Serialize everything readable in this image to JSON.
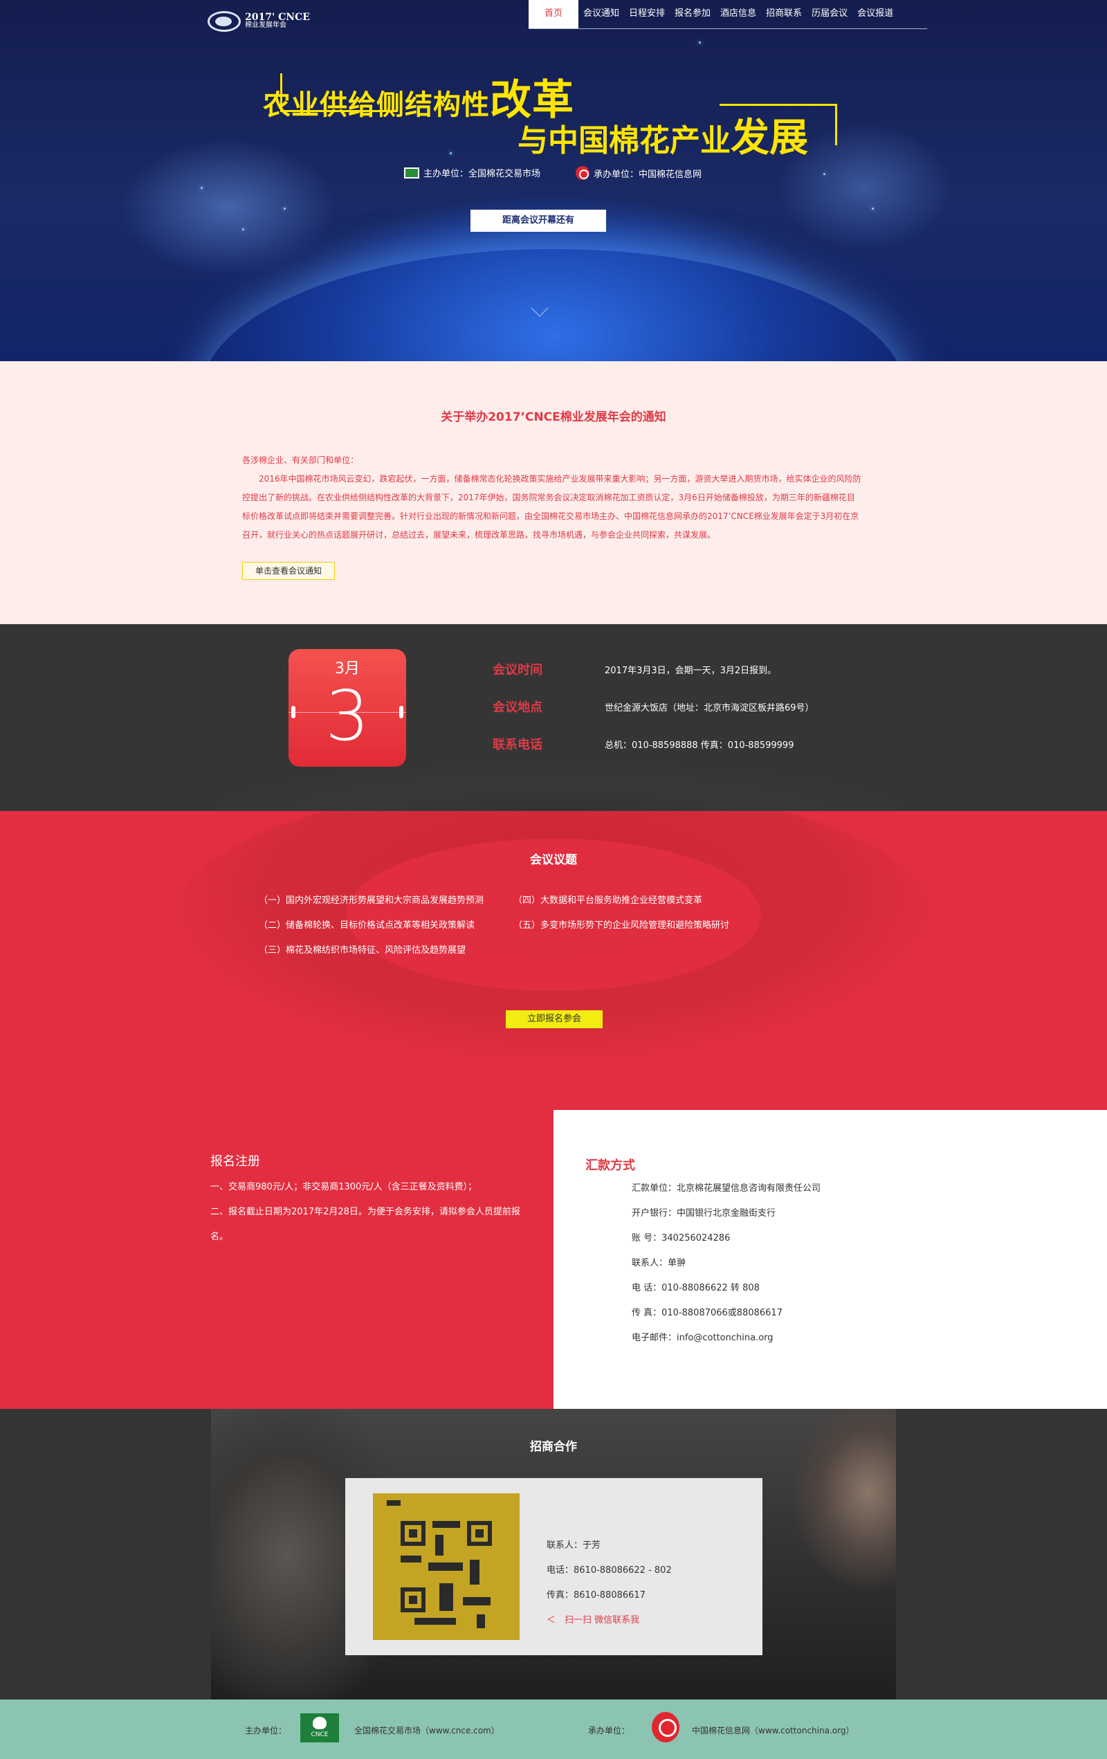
{
  "header": {
    "logo_year": "2017' CNCE",
    "logo_name": "棉业发展年会",
    "nav": [
      {
        "label": "首页",
        "active": true
      },
      {
        "label": "会议通知"
      },
      {
        "label": "日程安排"
      },
      {
        "label": "报名参加"
      },
      {
        "label": "酒店信息"
      },
      {
        "label": "招商联系"
      },
      {
        "label": "历届会议"
      },
      {
        "label": "会议报道"
      }
    ]
  },
  "hero": {
    "title_line1_a": "农业供给侧结构性",
    "title_line1_b": "改革",
    "title_line2_a": "与中国棉花产业",
    "title_line2_b": "发展",
    "host": "主办单位：全国棉花交易市场",
    "organizer": "承办单位：中国棉花信息网",
    "countdown": "距离会议开幕还有"
  },
  "notice": {
    "title": "关于举办2017’CNCE棉业发展年会的通知",
    "greeting": "各涉棉企业、有关部门和单位：",
    "body": "2016年中国棉花市场风云变幻，跌宕起伏，一方面，储备棉常态化轮换政策实施给产业发展带来重大影响；另一方面，游资大举进入期货市场，给实体企业的风险防控提出了新的挑战。在农业供给侧结构性改革的大背景下，2017年伊始，国务院常务会议决定取消棉花加工资质认定，3月6日开始储备棉投放，为期三年的新疆棉花目标价格改革试点即将结束并需要调整完善。针对行业出现的新情况和新问题，由全国棉花交易市场主办、中国棉花信息网承办的2017’CNCE棉业发展年会定于3月初在京召开，就行业关心的热点话题展开研讨，总结过去，展望未来，梳理改革思路，找寻市场机遇，与参会企业共同探索，共谋发展。",
    "button": "单击查看会议通知"
  },
  "info": {
    "calendar_month": "3月",
    "calendar_day": "3",
    "rows": [
      {
        "label": "会议时间",
        "value": "2017年3月3日，会期一天，3月2日报到。"
      },
      {
        "label": "会议地点",
        "value": "世纪金源大饭店（地址：北京市海淀区板井路69号）"
      },
      {
        "label": "联系电话",
        "value": "总机：010-88598888 传真：010-88599999"
      }
    ]
  },
  "agenda": {
    "title": "会议议题",
    "items": [
      "（一）国内外宏观经济形势展望和大宗商品发展趋势预测",
      "（二）储备棉轮换、目标价格试点改革等相关政策解读",
      "（三）棉花及棉纺织市场特征、风险评估及趋势展望",
      "（四）大数据和平台服务助推企业经营模式变革",
      "（五）多变市场形势下的企业风险管理和避险策略研讨"
    ],
    "button": "立即报名参会"
  },
  "registration": {
    "title": "报名注册",
    "line1": "一、交易商980元/人；非交易商1300元/人（含三正餐及资料费）；",
    "line2": "二、报名截止日期为2017年2月28日。为便于会务安排，请拟参会人员提前报名。"
  },
  "payment": {
    "title": "汇款方式",
    "lines": [
      "汇款单位：北京棉花展望信息咨询有限责任公司",
      "开户银行：中国银行北京金融街支行",
      "账 号：340256024286",
      "联系人：单翀",
      "电 话：010-88086622 转 808",
      "传 真：010-88087066或88086617",
      "电子邮件：info@cottonchina.org"
    ]
  },
  "sponsorship": {
    "title": "招商合作",
    "contact": "联系人：于芳",
    "phone": "电话：8610-88086622 - 802",
    "fax": "传真：8610-88086617",
    "wechat": "＜　扫一扫 微信联系我"
  },
  "footer": {
    "host_label": "主办单位：",
    "host_logo_text": "CNCE",
    "host_name": "全国棉花交易市场（www.cnce.com）",
    "organizer_label": "承办单位：",
    "organizer_name": "中国棉花信息网（www.cottonchina.org）"
  }
}
